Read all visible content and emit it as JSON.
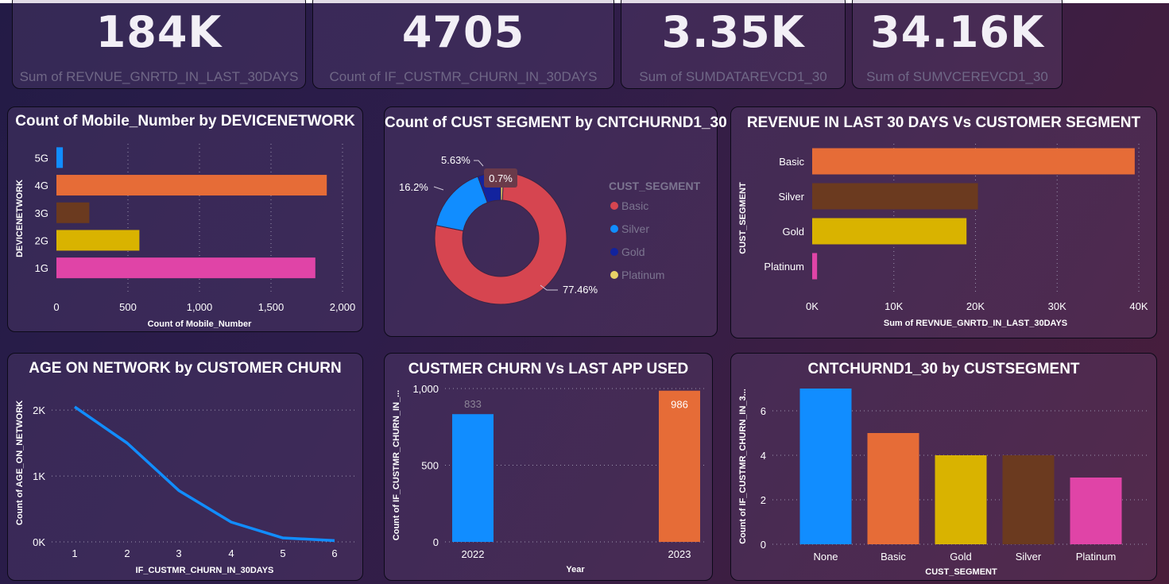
{
  "kpis": [
    {
      "value": "184K",
      "label": "Sum of REVNUE_GNRTD_IN_LAST_30DAYS"
    },
    {
      "value": "4705",
      "label": "Count of IF_CUSTMR_CHURN_IN_30DAYS"
    },
    {
      "value": "3.35K",
      "label": "Sum of SUMDATAREVCD1_30"
    },
    {
      "value": "34.16K",
      "label": "Sum of SUMVCEREVCD1_30"
    }
  ],
  "colors": {
    "blue": "#118dff",
    "orange": "#e66c37",
    "brown": "#6b3a1f",
    "gold": "#d9b300",
    "pink": "#e044a7",
    "red": "#d64550",
    "navy": "#12239e",
    "yellow": "#e8d166"
  },
  "chart_data": [
    {
      "type": "bar",
      "orientation": "horizontal",
      "title": "Count of Mobile_Number by DEVICENETWORK",
      "xlabel": "Count of Mobile_Number",
      "ylabel": "DEVICENETWORK",
      "categories": [
        "5G",
        "4G",
        "3G",
        "2G",
        "1G"
      ],
      "values": [
        45,
        1890,
        230,
        580,
        1810
      ],
      "xlim": [
        0,
        2000
      ],
      "xticks": [
        "0",
        "500",
        "1,000",
        "1,500",
        "2,000"
      ],
      "bar_colors": [
        "#118dff",
        "#e66c37",
        "#6b3a1f",
        "#d9b300",
        "#e044a7"
      ],
      "grid": true
    },
    {
      "type": "pie",
      "variant": "donut",
      "title": "Count of CUST SEGMENT by CNTCHURND1_30",
      "legend_title": "CUST_SEGMENT",
      "legend": "right",
      "categories": [
        "Basic",
        "Silver",
        "Gold",
        "Platinum"
      ],
      "values": [
        77.46,
        16.2,
        5.63,
        0.7
      ],
      "labels": [
        "77.46%",
        "16.2%",
        "5.63%",
        "0.7%"
      ],
      "slice_colors": [
        "#d64550",
        "#118dff",
        "#12239e",
        "#e8d166"
      ]
    },
    {
      "type": "bar",
      "orientation": "horizontal",
      "title": "REVENUE IN LAST 30 DAYS Vs CUSTOMER SEGMENT",
      "xlabel": "Sum of REVNUE_GNRTD_IN_LAST_30DAYS",
      "ylabel": "CUST_SEGMENT",
      "categories": [
        "Basic",
        "Silver",
        "Gold",
        "Platinum"
      ],
      "values": [
        39500,
        20300,
        18900,
        600
      ],
      "xlim": [
        0,
        40000
      ],
      "xticks": [
        "0K",
        "10K",
        "20K",
        "30K",
        "40K"
      ],
      "bar_colors": [
        "#e66c37",
        "#6b3a1f",
        "#d9b300",
        "#e044a7"
      ],
      "grid": true
    },
    {
      "type": "line",
      "title": "AGE ON NETWORK by CUSTOMER CHURN",
      "xlabel": "IF_CUSTMR_CHURN_IN_30DAYS",
      "ylabel": "Count of AGE_ON_NETWORK",
      "x": [
        1,
        2,
        3,
        4,
        5,
        6
      ],
      "values": [
        2050,
        1500,
        780,
        300,
        60,
        20
      ],
      "ylim": [
        0,
        2400
      ],
      "yticks": [
        "0K",
        "1K",
        "2K"
      ],
      "line_color": "#118dff",
      "grid": true
    },
    {
      "type": "bar",
      "title": "CUSTMER CHURN Vs LAST APP USED",
      "xlabel": "Year",
      "ylabel": "Count of IF_CUSTMR_CHURN_IN_...",
      "categories": [
        "2022",
        "2023"
      ],
      "values": [
        833,
        986
      ],
      "data_labels": [
        "833",
        "986"
      ],
      "ylim": [
        0,
        1000
      ],
      "yticks": [
        "0",
        "500",
        "1,000"
      ],
      "bar_colors": [
        "#118dff",
        "#e66c37"
      ],
      "grid": true
    },
    {
      "type": "bar",
      "title": "CNTCHURND1_30 by CUSTSEGMENT",
      "xlabel": "CUST_SEGMENT",
      "ylabel": "Count of IF_CUSTMR_CHURN_IN_3...",
      "categories": [
        "None",
        "Basic",
        "Gold",
        "Silver",
        "Platinum"
      ],
      "values": [
        7,
        5,
        4,
        4,
        3
      ],
      "ylim": [
        0,
        7
      ],
      "yticks": [
        "0",
        "2",
        "4",
        "6"
      ],
      "bar_colors": [
        "#118dff",
        "#e66c37",
        "#d9b300",
        "#6b3a1f",
        "#e044a7"
      ],
      "grid": true
    }
  ]
}
